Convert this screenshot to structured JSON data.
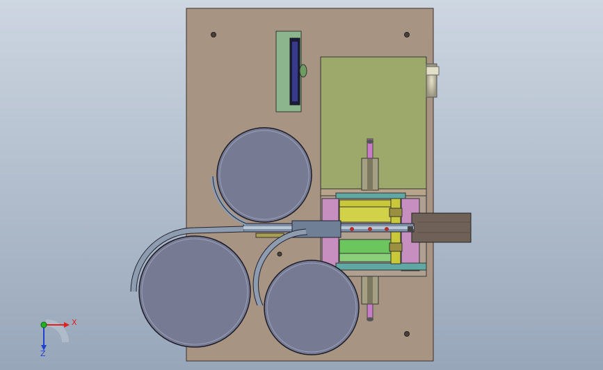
{
  "viewport": {
    "background_top": "#cdd6e1",
    "background_bottom": "#97a6b9"
  },
  "model": {
    "base_plate_color": "#a89482",
    "bowl_color": "#767b93",
    "motor_box_color": "#9da86b",
    "rail_color": "#c6c4ca",
    "chute_color": "#6f6158",
    "yellow_part_color": "#c8c83a",
    "green_part_color": "#6cc65e",
    "teal_part_color": "#5fa8a3",
    "pink_part_color": "#c78ec0"
  },
  "triad": {
    "x_label": "X",
    "z_label": "Z",
    "x_color": "#e02020",
    "z_color": "#2040d0",
    "y_color": "#20b020"
  }
}
